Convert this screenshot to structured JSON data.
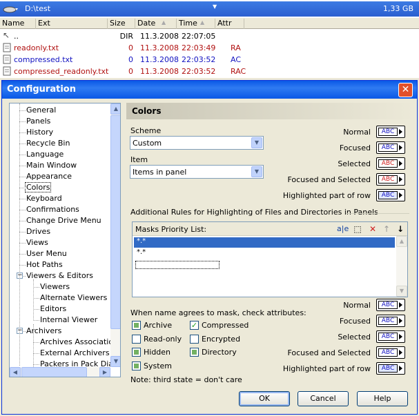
{
  "panel": {
    "path": "D:\\test",
    "dropdown": "▼",
    "free_space": "1,33 GB",
    "columns": [
      "Name",
      "Ext",
      "Size",
      "Date",
      "Time",
      "Attr"
    ],
    "files": [
      {
        "name": "..",
        "size": "DIR",
        "date": "11.3.2008",
        "time": "22:07:05",
        "attr": "",
        "color": "#000000"
      },
      {
        "name": "readonly.txt",
        "size": "0",
        "date": "11.3.2008",
        "time": "22:03:49",
        "attr": "RA",
        "color": "#b01010"
      },
      {
        "name": "compressed.txt",
        "size": "0",
        "date": "11.3.2008",
        "time": "22:03:52",
        "attr": "AC",
        "color": "#1010c0"
      },
      {
        "name": "compressed_readonly.txt",
        "size": "0",
        "date": "11.3.2008",
        "time": "22:03:52",
        "attr": "RAC",
        "color": "#b01010"
      }
    ]
  },
  "dialog": {
    "title": "Configuration",
    "close": "✕",
    "tree": [
      "General",
      "Panels",
      "History",
      "Recycle Bin",
      "Language",
      "Main Window",
      "Appearance",
      "Colors",
      "Keyboard",
      "Confirmations",
      "Change Drive Menu",
      "Drives",
      "Views",
      "User Menu",
      "Hot Paths",
      "Viewers & Editors",
      "Viewers",
      "Alternate Viewers",
      "Editors",
      "Internal Viewer",
      "Archivers",
      "Archives Associations",
      "External Archivers Lo",
      "Packers in Pack Dialo"
    ],
    "section_title": "Colors",
    "scheme_label": "Scheme",
    "scheme_value": "Custom",
    "item_label": "Item",
    "item_value": "Items in panel",
    "state_labels": [
      "Normal",
      "Focused",
      "Selected",
      "Focused and Selected",
      "Highlighted part of row"
    ],
    "abc": "ABC",
    "rules_label": "Additional Rules for Highlighting of Files and Directories in Panels",
    "masks_label": "Masks Priority List:",
    "masks": [
      "*.*",
      "*.*"
    ],
    "attr_label": "When name agrees to mask, check attributes:",
    "attrs": [
      "Archive",
      "Compressed",
      "Read-only",
      "Encrypted",
      "Hidden",
      "Directory",
      "System"
    ],
    "note": "Note: third state = don't care",
    "buttons": {
      "ok": "OK",
      "cancel": "Cancel",
      "help": "Help"
    },
    "colors": {
      "title_bar": "#0a58e6",
      "selection": "#316ac5",
      "red_text": "#b01010",
      "blue_text": "#1010c0"
    }
  }
}
